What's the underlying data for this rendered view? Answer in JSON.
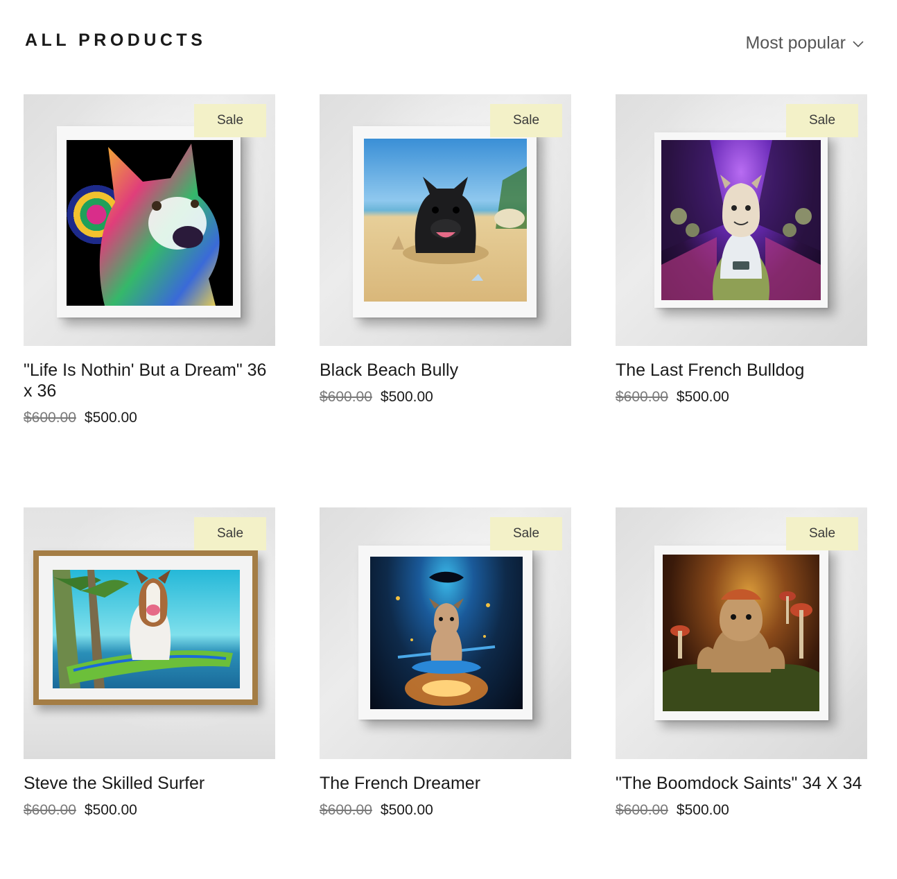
{
  "header": {
    "title": "ALL PRODUCTS",
    "sort_label": "Most popular"
  },
  "products": [
    {
      "title": "\"Life Is Nothin' But a Dream\" 36 x 36",
      "badge": "Sale",
      "price_old": "$600.00",
      "price_new": "$500.00"
    },
    {
      "title": "Black Beach Bully",
      "badge": "Sale",
      "price_old": "$600.00",
      "price_new": "$500.00"
    },
    {
      "title": "The Last French Bulldog",
      "badge": "Sale",
      "price_old": "$600.00",
      "price_new": "$500.00"
    },
    {
      "title": "Steve the Skilled Surfer",
      "badge": "Sale",
      "price_old": "$600.00",
      "price_new": "$500.00"
    },
    {
      "title": "The French Dreamer",
      "badge": "Sale",
      "price_old": "$600.00",
      "price_new": "$500.00"
    },
    {
      "title": "\"The Boomdock Saints\" 34 X 34",
      "badge": "Sale",
      "price_old": "$600.00",
      "price_new": "$500.00"
    }
  ],
  "colors": {
    "badge_bg": "#f3f1c8",
    "text": "#1a1a1a",
    "muted": "#7a7a7a"
  }
}
